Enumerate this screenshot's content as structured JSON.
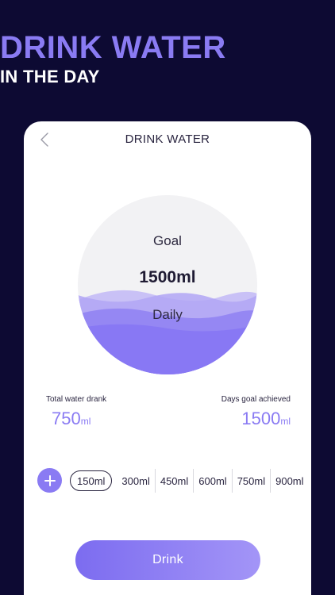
{
  "hero": {
    "title": "DRINK WATER",
    "subtitle": "IN THE DAY"
  },
  "screen": {
    "title": "DRINK WATER",
    "back_icon": "chevron-left-icon"
  },
  "goal": {
    "label": "Goal",
    "value": "1500ml",
    "daily_label": "Daily"
  },
  "stats": {
    "total_label": "Total water drank",
    "total_value": "750",
    "total_unit": "ml",
    "days_label": "Days goal achieved",
    "days_value": "1500",
    "days_unit": "ml"
  },
  "amounts": {
    "add_icon": "plus-icon",
    "selected": "150ml",
    "options": [
      "150ml",
      "300ml",
      "450ml",
      "600ml",
      "750ml",
      "900ml"
    ]
  },
  "drink_button": "Drink",
  "colors": {
    "background": "#0d0a33",
    "accent": "#8a7bf3",
    "card": "#ffffff"
  }
}
